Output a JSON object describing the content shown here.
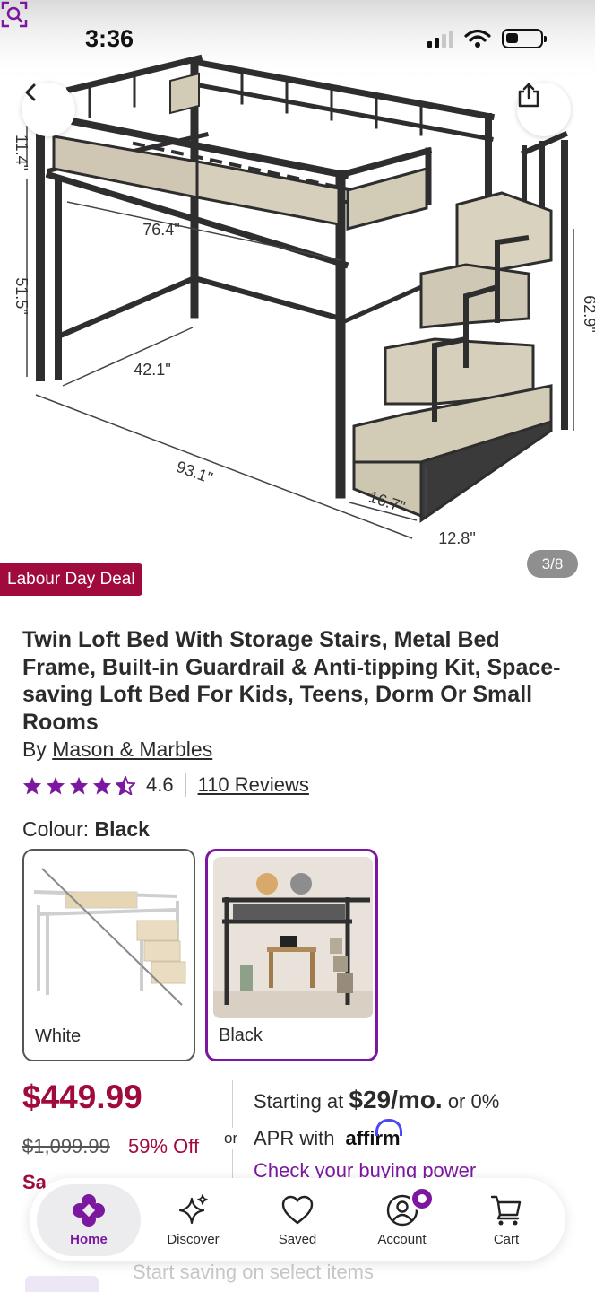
{
  "status_bar": {
    "time": "3:36"
  },
  "hero": {
    "image_counter": "3/8",
    "deal_label": "Labour Day Deal",
    "dimensions": {
      "guardrail": "11.4\"",
      "length_top": "76.4\"",
      "clearance": "51.5\"",
      "width": "42.1\"",
      "total_length": "93.1\"",
      "stair_depth": "16.7\"",
      "step": "12.8\"",
      "height": "62.9\""
    }
  },
  "product": {
    "title": "Twin Loft Bed With Storage Stairs, Metal Bed Frame, Built-in Guardrail & Anti-tipping Kit, Space-saving Loft Bed For Kids, Teens, Dorm Or Small Rooms",
    "by_prefix": "By",
    "brand": "Mason & Marbles",
    "rating": "4.6",
    "rating_stars": 4.6,
    "reviews": "110 Reviews",
    "colour_label": "Colour:",
    "colour_value": "Black",
    "swatches": [
      {
        "label": "White",
        "selected": false,
        "available": false
      },
      {
        "label": "Black",
        "selected": true,
        "available": true
      }
    ]
  },
  "pricing": {
    "price": "$449.99",
    "was_price": "$1,099.99",
    "discount": "59% Off",
    "sale_peek": "Sa",
    "or": "or",
    "financing_prefix": "Starting at",
    "financing_amount": "$29/mo.",
    "financing_rate": "or 0%",
    "financing_line2": "APR with",
    "affirm_brand": "affirm",
    "financing_link": "Check your buying power"
  },
  "bottom_nav": {
    "items": [
      {
        "label": "Home",
        "icon": "home-flower-icon",
        "active": true
      },
      {
        "label": "Discover",
        "icon": "sparkle-icon",
        "active": false
      },
      {
        "label": "Saved",
        "icon": "heart-icon",
        "active": false
      },
      {
        "label": "Account",
        "icon": "account-icon",
        "active": false
      },
      {
        "label": "Cart",
        "icon": "cart-icon",
        "active": false
      }
    ]
  },
  "promo_text": "Start saving on select items",
  "colors": {
    "brand_purple": "#7b189f",
    "sale_red": "#a10a3c",
    "affirm_blue": "#4a4af4"
  }
}
